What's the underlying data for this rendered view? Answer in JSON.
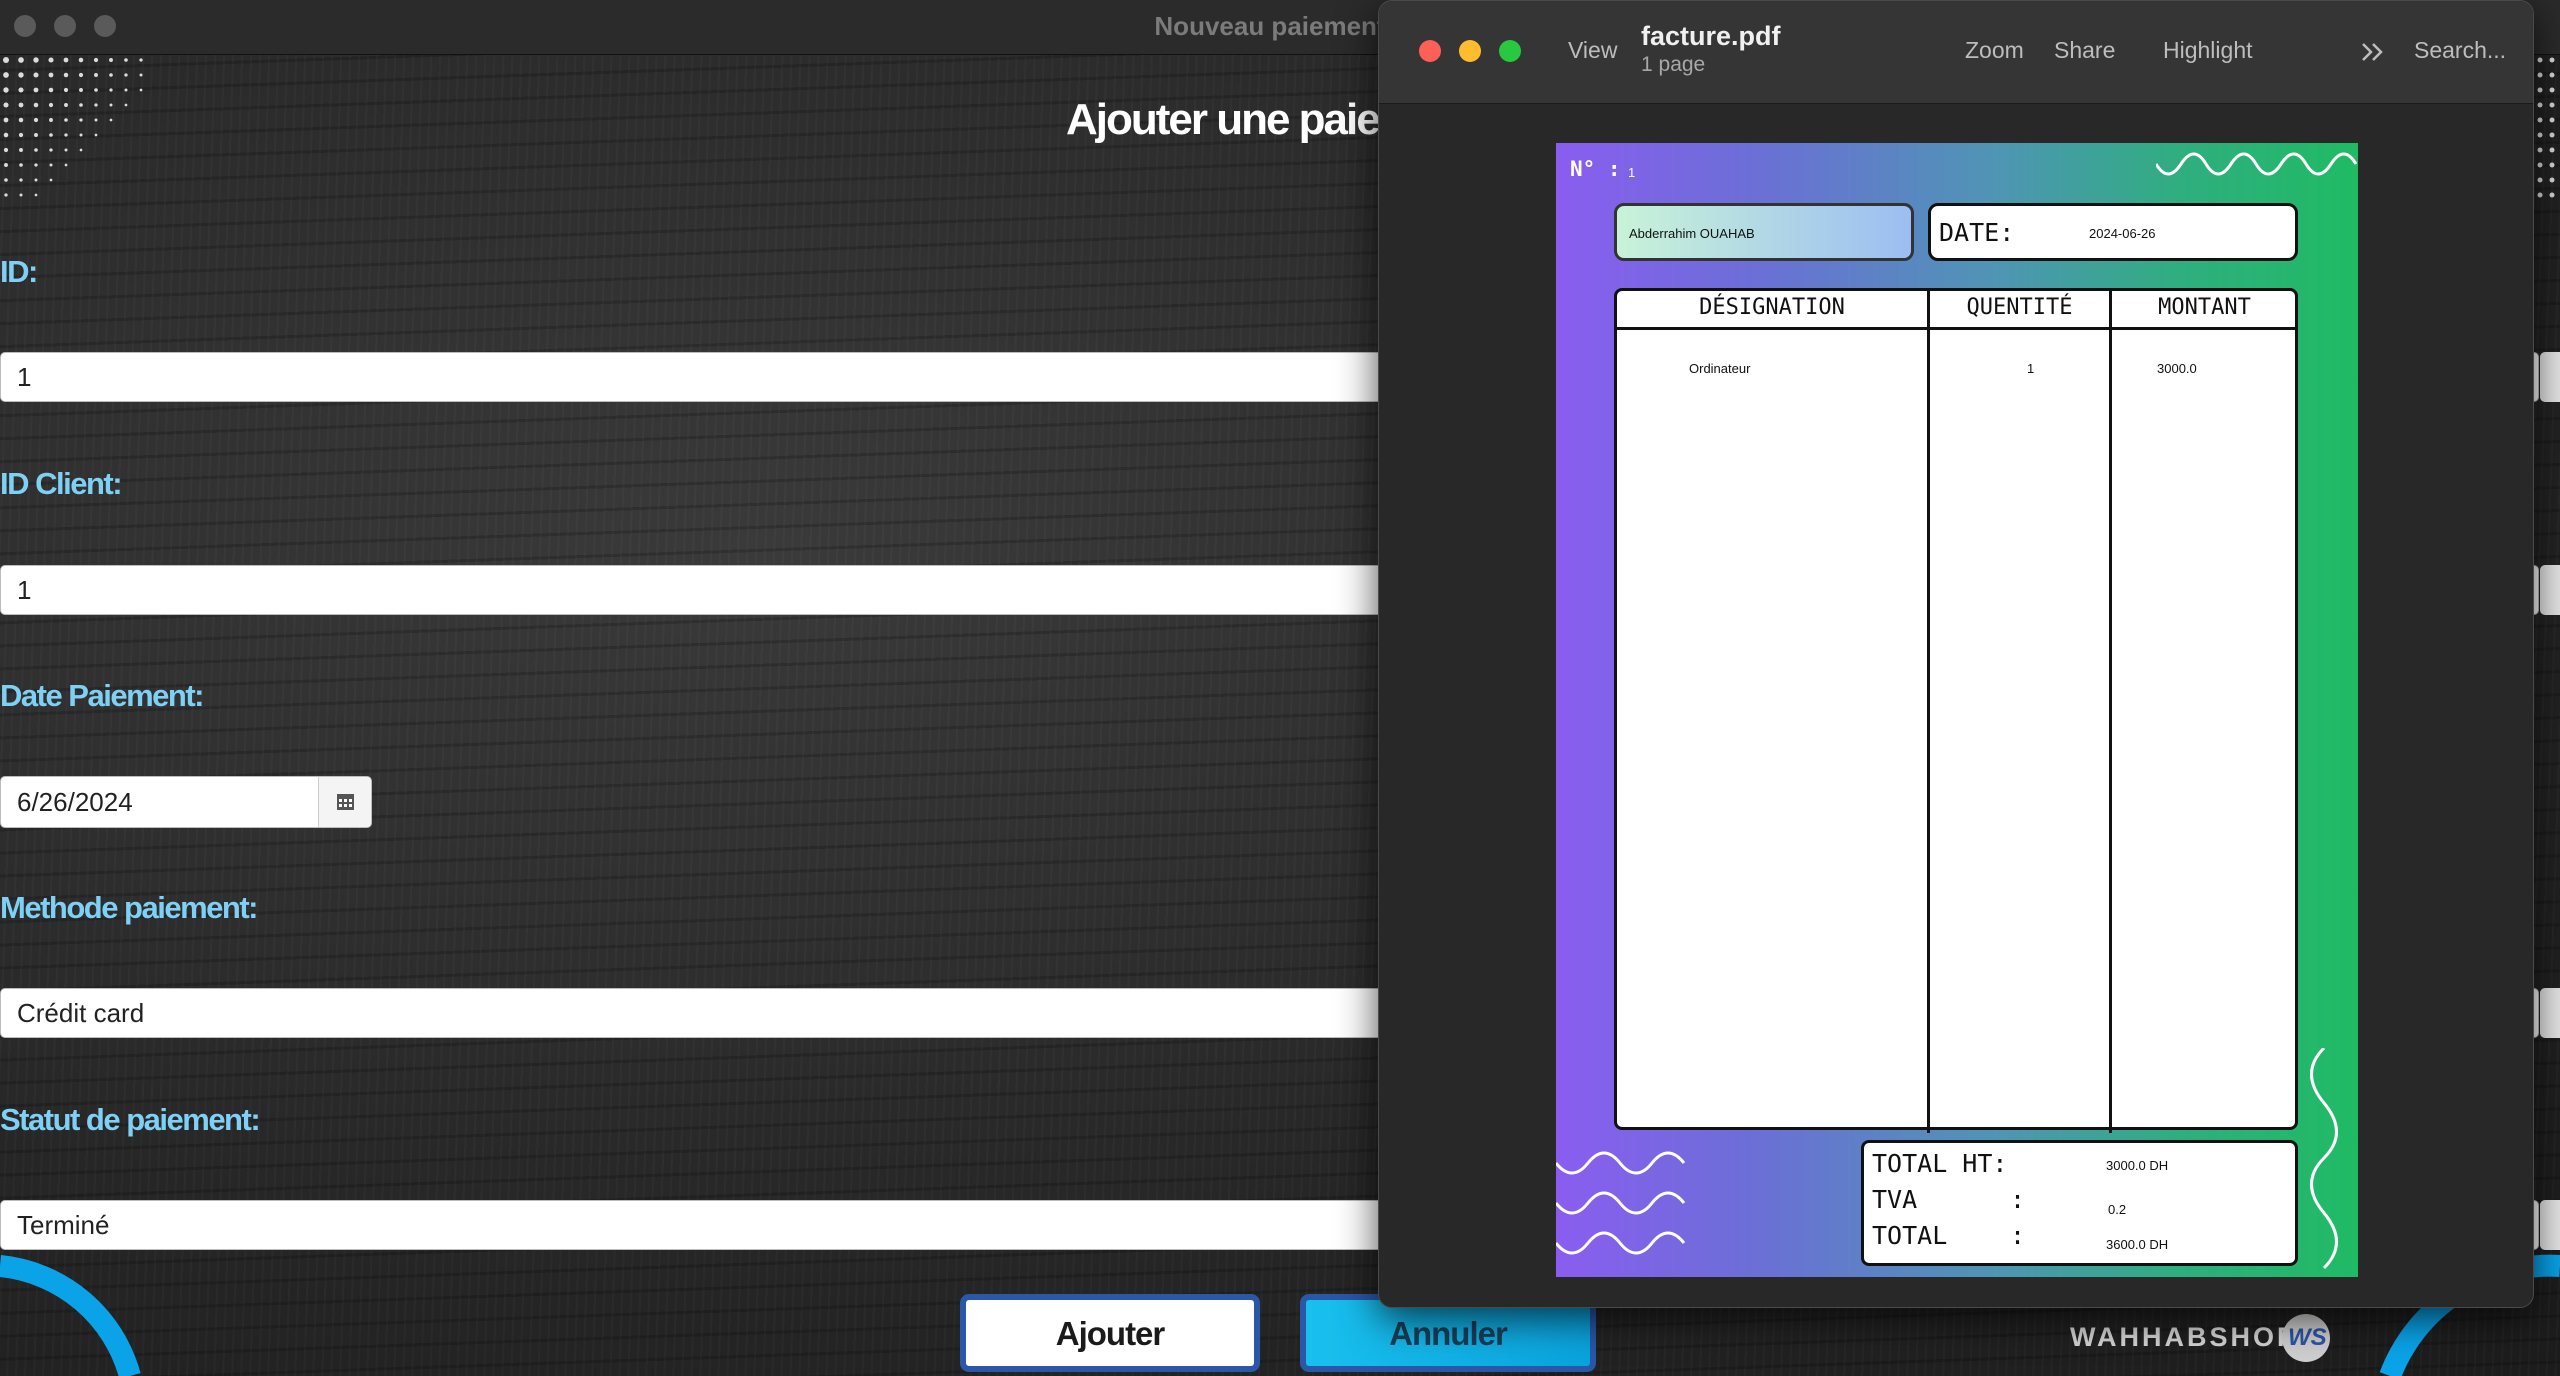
{
  "app": {
    "window_title": "Nouveau paiement",
    "heading": "Ajouter une paiement",
    "fields": {
      "id_label": "ID:",
      "id_value": "1",
      "client_label": "ID Client:",
      "client_value": "1",
      "date_label": "Date Paiement:",
      "date_value": "6/26/2024",
      "method_label": "Methode paiement:",
      "method_value": "Crédit card",
      "status_label": "Statut de paiement:",
      "status_value": "Terminé"
    },
    "buttons": {
      "add": "Ajouter",
      "cancel": "Annuler"
    },
    "brand": "WAHHABSHOP",
    "brand_logo": "WS",
    "colors": {
      "label": "#7fd0f5",
      "button_border": "#2a57a8",
      "cancel_bg": "#19c0ee"
    }
  },
  "preview": {
    "filename": "facture.pdf",
    "pages": "1 page",
    "toolbar": {
      "view": "View",
      "zoom": "Zoom",
      "share": "Share",
      "highlight": "Highlight",
      "more_icon": "chevron-double-right-icon",
      "search": "Search..."
    },
    "invoice": {
      "number_label": "N° :",
      "number": "1",
      "client_name": "Abderrahim OUAHAB",
      "date_label": "DATE:",
      "date": "2024-06-26",
      "columns": [
        "DÉSIGNATION",
        "QUENTITÉ",
        "MONTANT"
      ],
      "rows": [
        {
          "designation": "Ordinateur",
          "quantity": "1",
          "amount": "3000.0"
        }
      ],
      "totals": {
        "ht_label": "TOTAL HT:",
        "ht_value": "3000.0 DH",
        "tva_label": "TVA",
        "tva_colon": ":",
        "tva_value": "0.2",
        "total_label": "TOTAL",
        "total_colon": ":",
        "total_value": "3600.0 DH"
      },
      "gradient": [
        "#8a5df0",
        "#1fbb63"
      ]
    }
  }
}
